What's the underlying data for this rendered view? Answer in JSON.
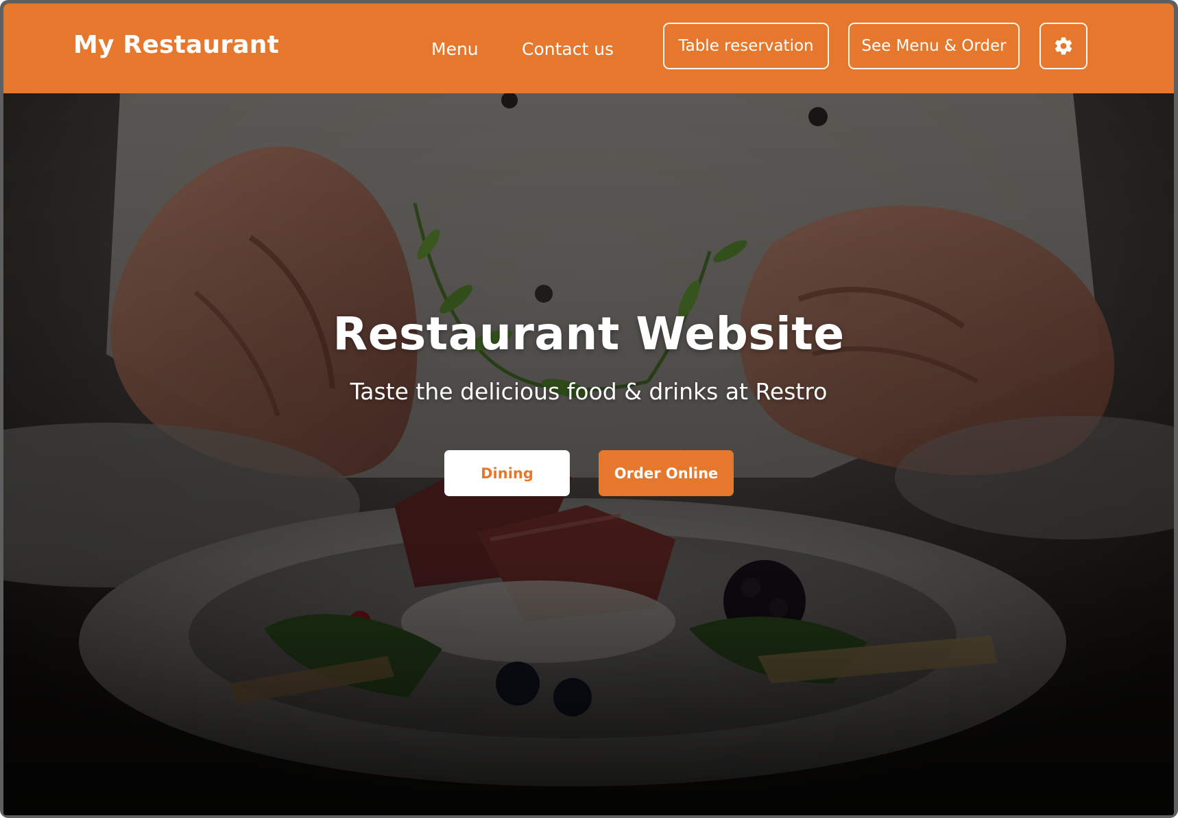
{
  "header": {
    "brand": "My Restaurant",
    "nav": {
      "menu": "Menu",
      "contact": "Contact us"
    },
    "buttons": {
      "reservation": "Table reservation",
      "see_menu_order": "See Menu & Order",
      "settings_icon": "gear-icon"
    }
  },
  "hero": {
    "title": "Restaurant Website",
    "subtitle": "Taste the delicious food & drinks at Restro",
    "buttons": {
      "dining": "Dining",
      "order_online": "Order Online"
    },
    "background_image": "chef plating a dish of sliced meat, berries and greens"
  },
  "colors": {
    "brand_orange": "#E5782D",
    "white": "#FFFFFF",
    "hero_overlay": "#1a1714"
  }
}
